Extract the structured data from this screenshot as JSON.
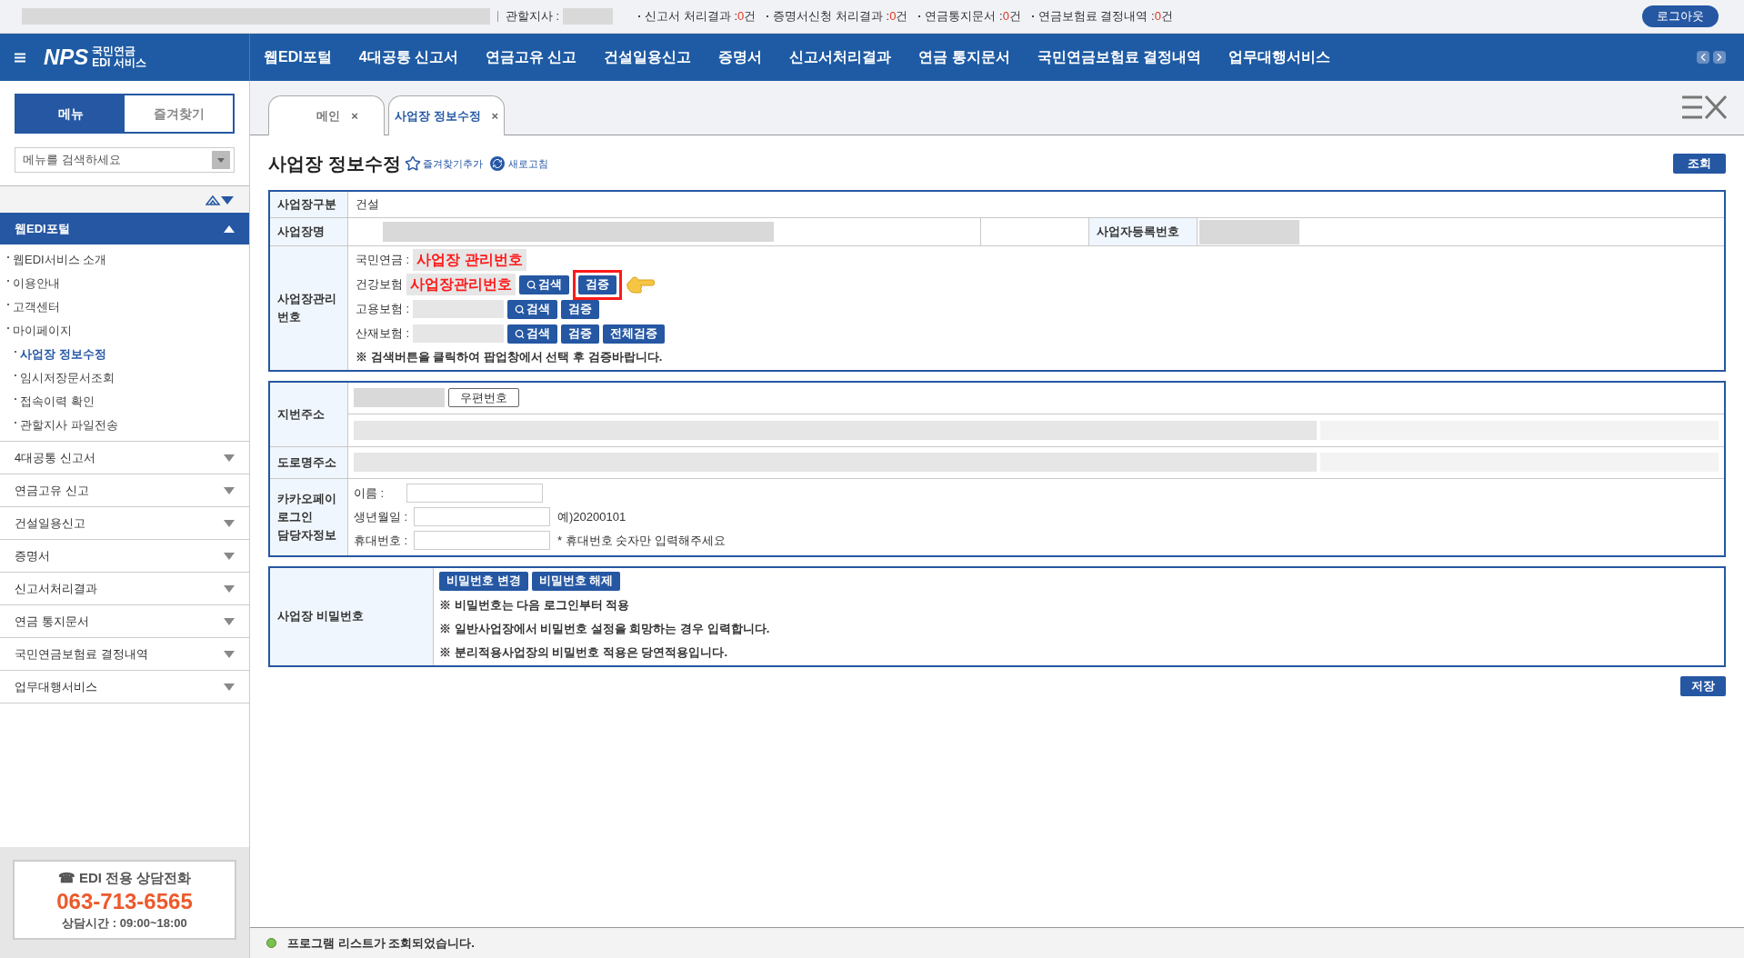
{
  "top_bar": {
    "branch_label": "관할지사 :",
    "counters": [
      {
        "label": "신고서 처리결과 :",
        "count": "0",
        "unit": "건"
      },
      {
        "label": "증명서신청 처리결과 :",
        "count": "0",
        "unit": "건"
      },
      {
        "label": "연금통지문서 :",
        "count": "0",
        "unit": "건"
      },
      {
        "label": "연금보험료 결정내역 :",
        "count": "0",
        "unit": "건"
      }
    ],
    "logout": "로그아웃"
  },
  "nav": {
    "logo": {
      "mark": "NPS",
      "line1": "국민연금",
      "line2": "EDI 서비스"
    },
    "items": [
      "웹EDI포털",
      "4대공통 신고서",
      "연금고유 신고",
      "건설일용신고",
      "증명서",
      "신고서처리결과",
      "연금 통지문서",
      "국민연금보험료 결정내역",
      "업무대행서비스"
    ]
  },
  "sidebar": {
    "tabs": [
      {
        "label": "메뉴",
        "selected": true
      },
      {
        "label": "즐겨찾기",
        "selected": false
      }
    ],
    "search": {
      "placeholder": "메뉴를 검색하세요"
    },
    "sections": [
      {
        "label": "웹EDI포털",
        "expanded": true,
        "children": [
          {
            "label": "웹EDI서비스 소개",
            "selected": false
          },
          {
            "label": "이용안내",
            "selected": false
          },
          {
            "label": "고객센터",
            "selected": false
          },
          {
            "label": "마이페이지",
            "selected": false,
            "children": [
              {
                "label": "사업장 정보수정",
                "selected": true
              },
              {
                "label": "임시저장문서조회",
                "selected": false
              },
              {
                "label": "접속이력 확인",
                "selected": false
              },
              {
                "label": "관할지사 파일전송",
                "selected": false
              }
            ]
          }
        ]
      },
      {
        "label": "4대공통 신고서",
        "expanded": false
      },
      {
        "label": "연금고유 신고",
        "expanded": false
      },
      {
        "label": "건설일용신고",
        "expanded": false
      },
      {
        "label": "증명서",
        "expanded": false
      },
      {
        "label": "신고서처리결과",
        "expanded": false
      },
      {
        "label": "연금 통지문서",
        "expanded": false
      },
      {
        "label": "국민연금보험료 결정내역",
        "expanded": false
      },
      {
        "label": "업무대행서비스",
        "expanded": false
      }
    ],
    "contact": {
      "title": "☎ EDI 전용 상담전화",
      "phone": "063-713-6565",
      "hours": "상담시간 : 09:00~18:00"
    }
  },
  "tabs": [
    {
      "label": "메인",
      "selected": false,
      "close": "×"
    },
    {
      "label": "사업장 정보수정",
      "selected": true,
      "close": "×"
    }
  ],
  "page": {
    "title": "사업장 정보수정",
    "favorite": "즐겨찾기추가",
    "refresh": "새로고침",
    "query_button": "조회",
    "save_button": "저장"
  },
  "business": {
    "type_label": "사업장구분",
    "type_value": "건설",
    "name_label": "사업장명",
    "reg_label": "사업자등록번호",
    "mgmt_label": "사업장관리번호",
    "insurances": [
      {
        "label": "국민연금 :",
        "annotation": "사업장 관리번호"
      },
      {
        "label": "건강보험",
        "annotation": "사업장관리번호",
        "buttons": [
          {
            "label": "검색",
            "kind": "search",
            "highlighted": false
          },
          {
            "label": "검증",
            "kind": "verify",
            "highlighted": true
          }
        ]
      },
      {
        "label": "고용보험 :",
        "buttons": [
          {
            "label": "검색",
            "kind": "search",
            "highlighted": false
          },
          {
            "label": "검증",
            "kind": "verify",
            "highlighted": false
          }
        ]
      },
      {
        "label": "산재보험 :",
        "buttons": [
          {
            "label": "검색",
            "kind": "search",
            "highlighted": false
          },
          {
            "label": "검증",
            "kind": "verify",
            "highlighted": false
          },
          {
            "label": "전체검증",
            "kind": "verify",
            "highlighted": false
          }
        ]
      }
    ],
    "note": "※ 검색버튼을 클릭하여 팝업창에서 선택 후 검증바랍니다."
  },
  "address": {
    "lot_label": "지번주소",
    "zip_button": "우편번호",
    "road_label": "도로명주소",
    "kakao_label": "카카오페이\n로그인\n담당자정보",
    "kakao_fields": [
      {
        "label": "이름 :"
      },
      {
        "label": "생년월일 :",
        "hint": "예)20200101"
      },
      {
        "label": "휴대번호 :",
        "hint": "* 휴대번호 숫자만 입력해주세요"
      }
    ]
  },
  "password": {
    "label": "사업장 비밀번호",
    "buttons": [
      "비밀번호 변경",
      "비밀번호 해제"
    ],
    "notes": [
      "※ 비밀번호는 다음 로그인부터 적용",
      "※ 일반사업장에서 비밀번호 설정을 희망하는 경우 입력합니다.",
      "※ 분리적용사업장의 비밀번호 적용은 당연적용입니다."
    ]
  },
  "status_bar": {
    "message": "프로그램 리스트가 조회되었습니다."
  }
}
